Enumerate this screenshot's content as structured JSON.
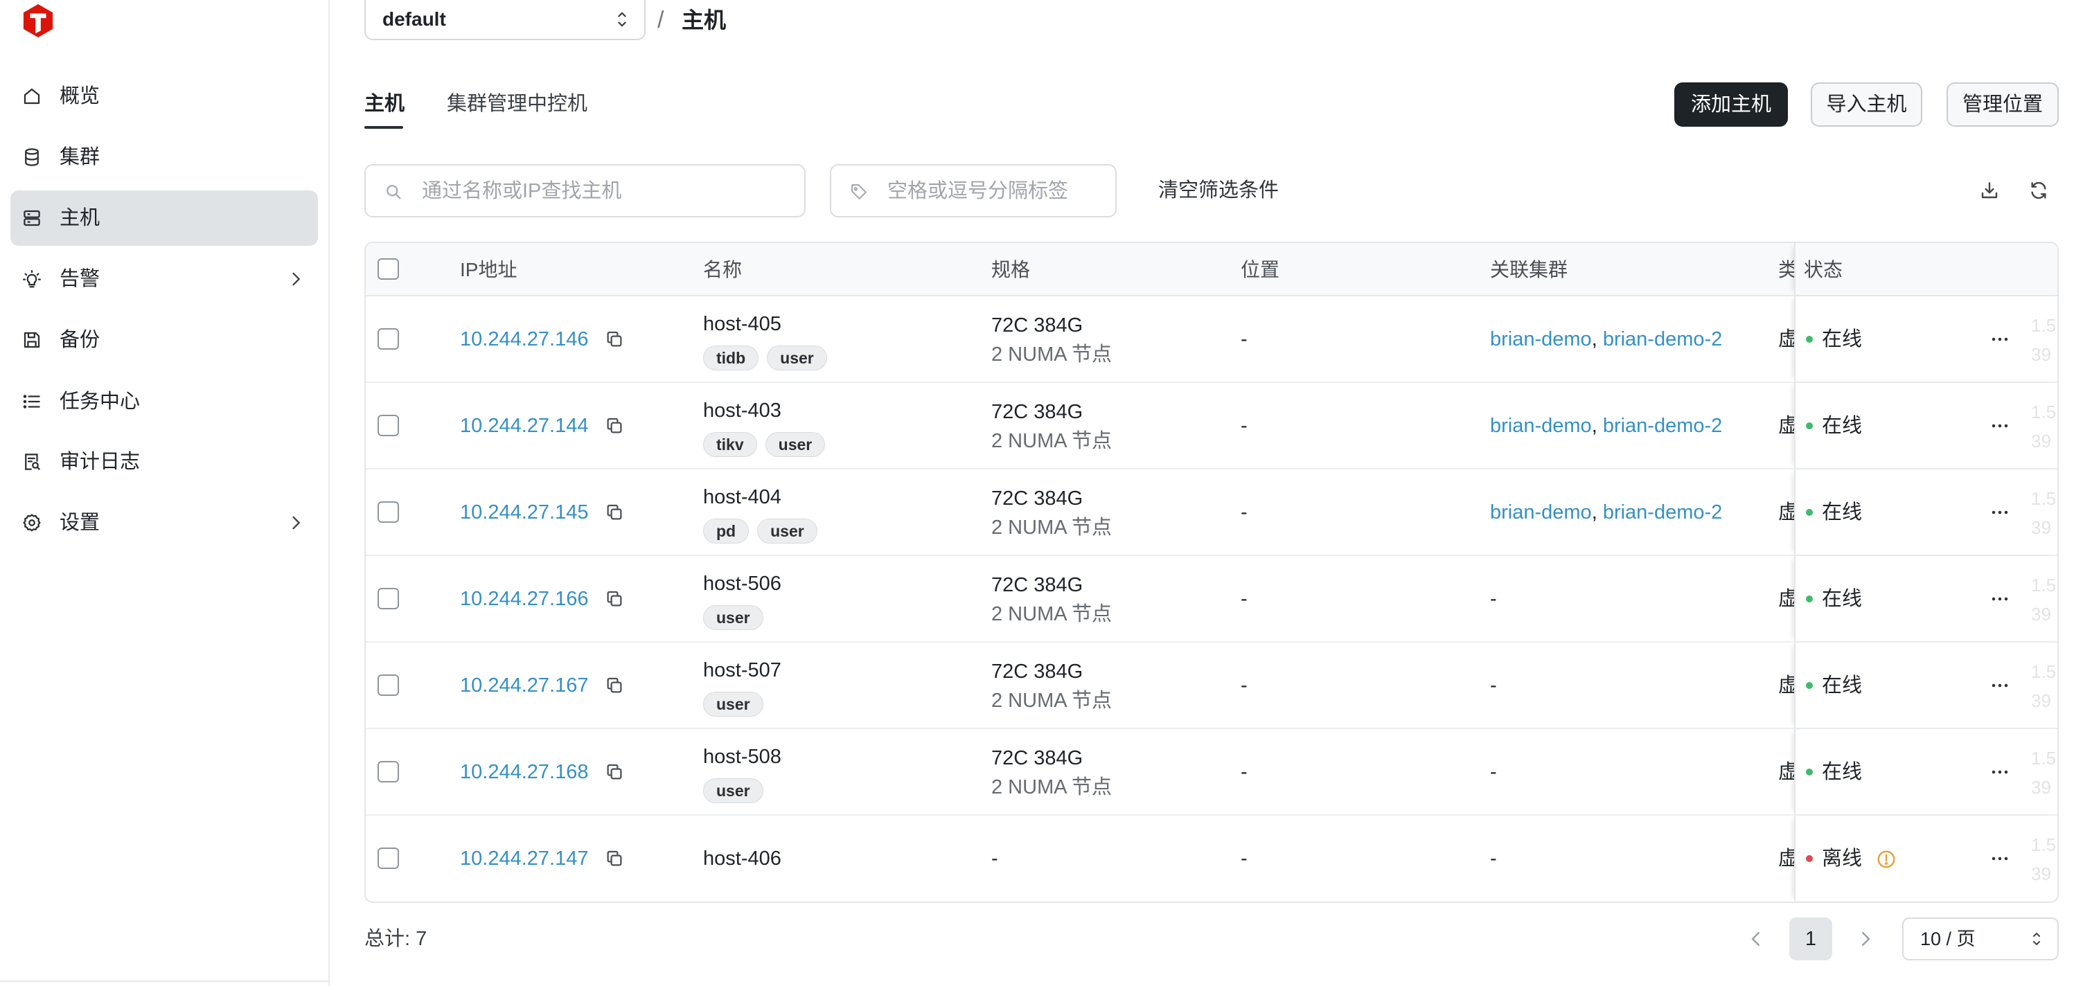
{
  "app": {
    "logo_icon": "tidb-logo"
  },
  "sidebar": {
    "items": [
      {
        "label": "概览",
        "icon": "home-icon"
      },
      {
        "label": "集群",
        "icon": "database-icon"
      },
      {
        "label": "主机",
        "icon": "server-icon",
        "active": true
      },
      {
        "label": "告警",
        "icon": "bulb-icon",
        "has_children": true
      },
      {
        "label": "备份",
        "icon": "save-icon"
      },
      {
        "label": "任务中心",
        "icon": "list-icon"
      },
      {
        "label": "审计日志",
        "icon": "audit-icon"
      },
      {
        "label": "设置",
        "icon": "gear-icon",
        "has_children": true
      }
    ]
  },
  "topbar": {
    "namespace": "default",
    "separator": "/",
    "page_title": "主机"
  },
  "tabs": [
    {
      "label": "主机",
      "active": true
    },
    {
      "label": "集群管理中控机",
      "active": false
    }
  ],
  "actions": {
    "add": "添加主机",
    "import": "导入主机",
    "locations": "管理位置"
  },
  "filters": {
    "search_placeholder": "通过名称或IP查找主机",
    "tag_placeholder": "空格或逗号分隔标签",
    "clear": "清空筛选条件"
  },
  "table": {
    "columns": {
      "ip": "IP地址",
      "name": "名称",
      "spec": "规格",
      "location": "位置",
      "clusters": "关联集群",
      "type": "类",
      "status": "状态"
    },
    "empty_value": "-",
    "cluster_separator": ", ",
    "rows": [
      {
        "ip": "10.244.27.146",
        "name": "host-405",
        "tags": [
          "tidb",
          "user"
        ],
        "spec": [
          "72C 384G",
          "2 NUMA 节点"
        ],
        "location": "-",
        "clusters": [
          "brian-demo",
          "brian-demo-2"
        ],
        "type": "虚",
        "status": "在线",
        "status_color": "#3dbb6c",
        "warning": false,
        "faded": [
          "1.5",
          "39"
        ]
      },
      {
        "ip": "10.244.27.144",
        "name": "host-403",
        "tags": [
          "tikv",
          "user"
        ],
        "spec": [
          "72C 384G",
          "2 NUMA 节点"
        ],
        "location": "-",
        "clusters": [
          "brian-demo",
          "brian-demo-2"
        ],
        "type": "虚",
        "status": "在线",
        "status_color": "#3dbb6c",
        "warning": false,
        "faded": [
          "1.5",
          "39"
        ]
      },
      {
        "ip": "10.244.27.145",
        "name": "host-404",
        "tags": [
          "pd",
          "user"
        ],
        "spec": [
          "72C 384G",
          "2 NUMA 节点"
        ],
        "location": "-",
        "clusters": [
          "brian-demo",
          "brian-demo-2"
        ],
        "type": "虚",
        "status": "在线",
        "status_color": "#3dbb6c",
        "warning": false,
        "faded": [
          "1.5",
          "39"
        ]
      },
      {
        "ip": "10.244.27.166",
        "name": "host-506",
        "tags": [
          "user"
        ],
        "spec": [
          "72C 384G",
          "2 NUMA 节点"
        ],
        "location": "-",
        "clusters": [],
        "type": "虚",
        "status": "在线",
        "status_color": "#3dbb6c",
        "warning": false,
        "faded": [
          "1.5",
          "39"
        ]
      },
      {
        "ip": "10.244.27.167",
        "name": "host-507",
        "tags": [
          "user"
        ],
        "spec": [
          "72C 384G",
          "2 NUMA 节点"
        ],
        "location": "-",
        "clusters": [],
        "type": "虚",
        "status": "在线",
        "status_color": "#3dbb6c",
        "warning": false,
        "faded": [
          "1.5",
          "39"
        ]
      },
      {
        "ip": "10.244.27.168",
        "name": "host-508",
        "tags": [
          "user"
        ],
        "spec": [
          "72C 384G",
          "2 NUMA 节点"
        ],
        "location": "-",
        "clusters": [],
        "type": "虚",
        "status": "在线",
        "status_color": "#3dbb6c",
        "warning": false,
        "faded": [
          "1.5",
          "39"
        ]
      },
      {
        "ip": "10.244.27.147",
        "name": "host-406",
        "tags": [],
        "spec": [
          "-"
        ],
        "location": "-",
        "clusters": [],
        "type": "虚",
        "status": "离线",
        "status_color": "#e5484d",
        "warning": true,
        "faded": [
          "1.5",
          "39"
        ]
      }
    ]
  },
  "pagination": {
    "total_label": "总计: 7",
    "current_page": "1",
    "page_size": "10 / 页"
  },
  "colors": {
    "accent": "#3490c6",
    "primary_button": "#1d2327",
    "online": "#3dbb6c",
    "offline": "#e5484d",
    "warning": "#e6a23c",
    "nav_selected": "#dfe3e6",
    "logo": "#dc150b"
  }
}
